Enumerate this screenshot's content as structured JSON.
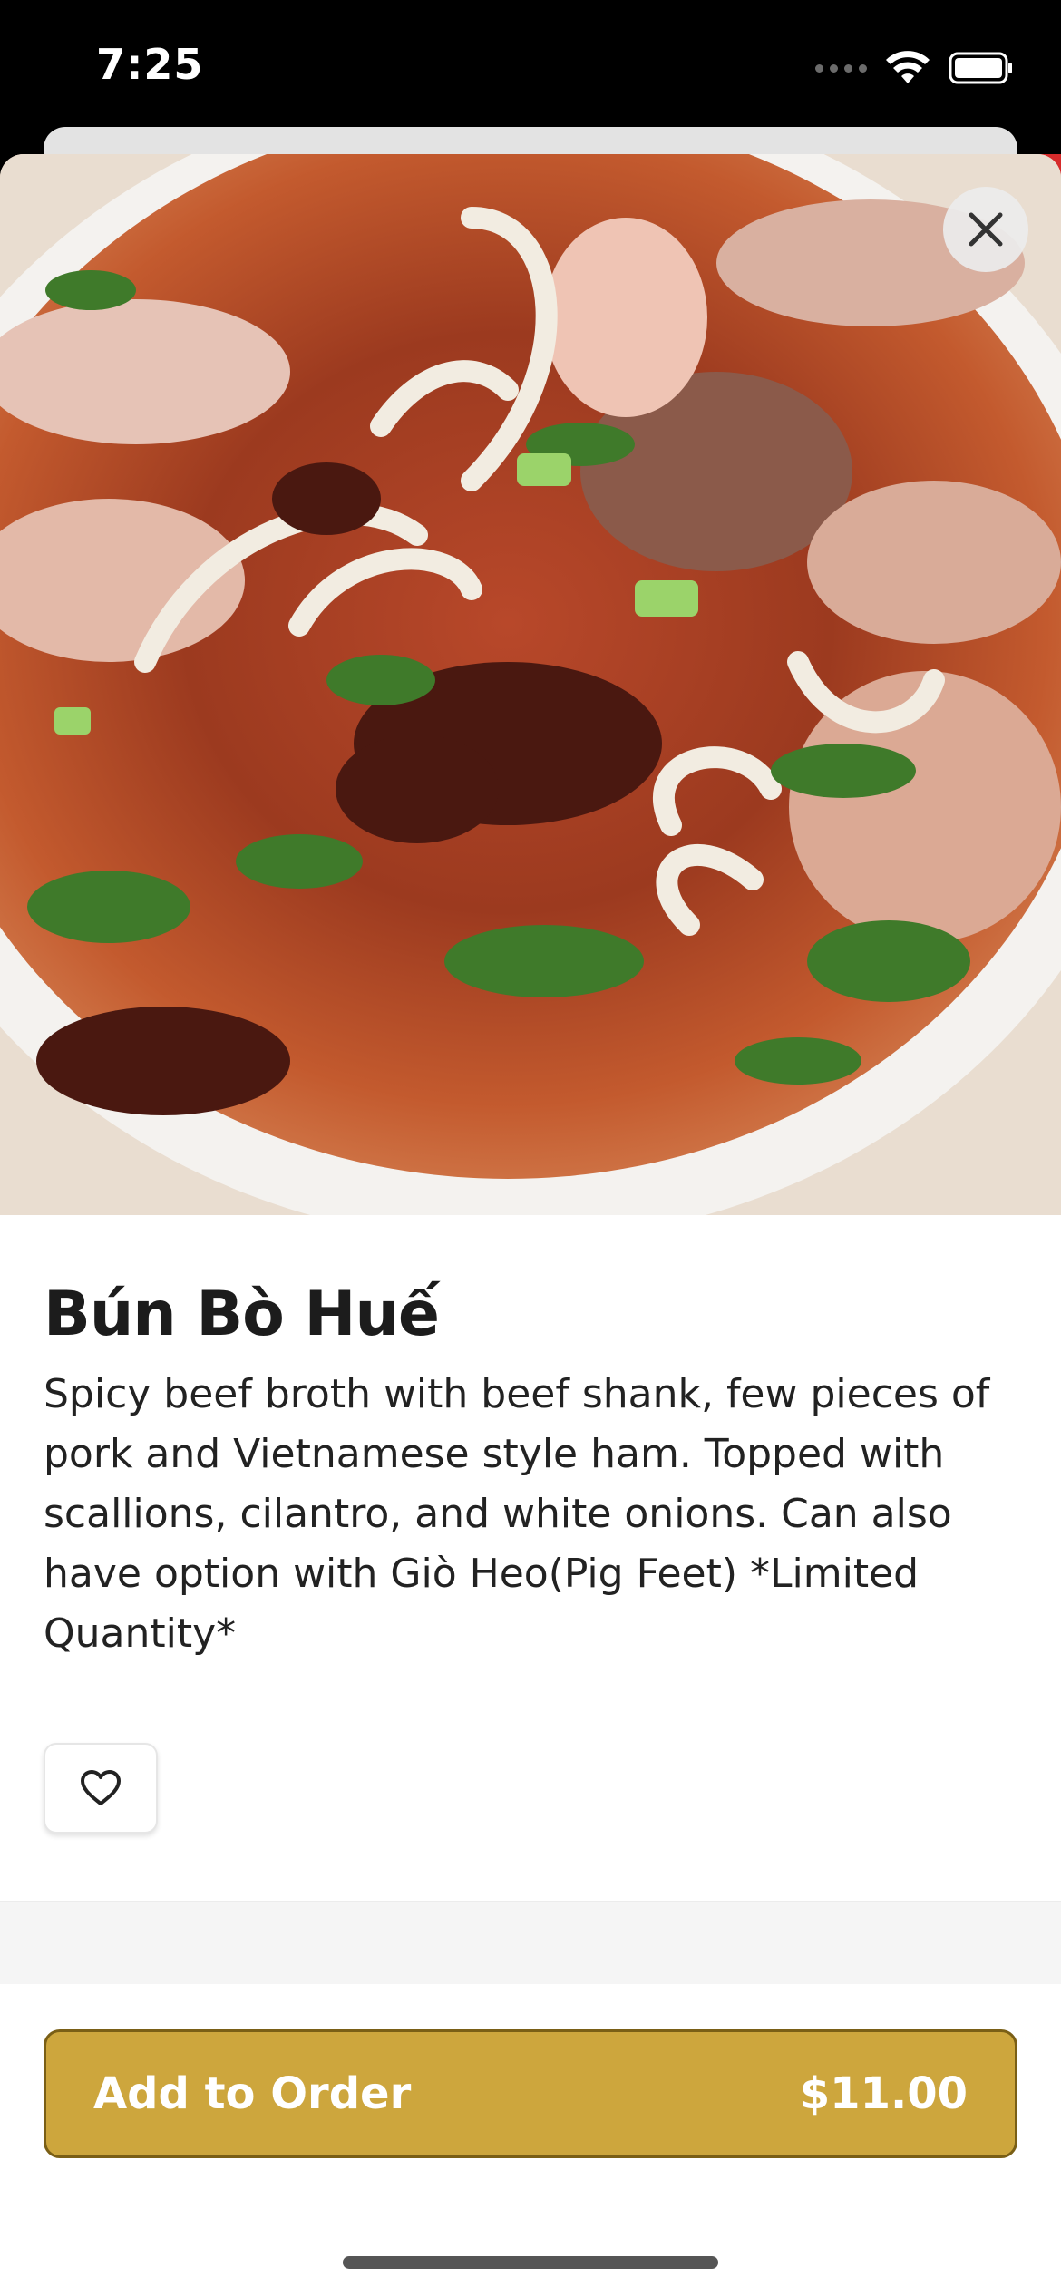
{
  "status_bar": {
    "time": "7:25",
    "icons": [
      "signal-icon",
      "wifi-icon",
      "battery-icon"
    ]
  },
  "item": {
    "title": "Bún Bò Huế",
    "description": "Spicy beef broth with beef shank, few pieces of pork and Vietnamese style ham. Topped with scallions, cilantro, and white onions. Can also have option with Giò Heo(Pig Feet) *Limited Quantity*",
    "image_icon": "soup-bowl-photo"
  },
  "actions": {
    "close_icon": "close-icon",
    "favorite_icon": "heart-icon",
    "add_label": "Add to Order",
    "price": "$11.00"
  },
  "colors": {
    "accent": "#cda63d",
    "accent_border": "#7a5f16",
    "status_bg": "#000000"
  }
}
